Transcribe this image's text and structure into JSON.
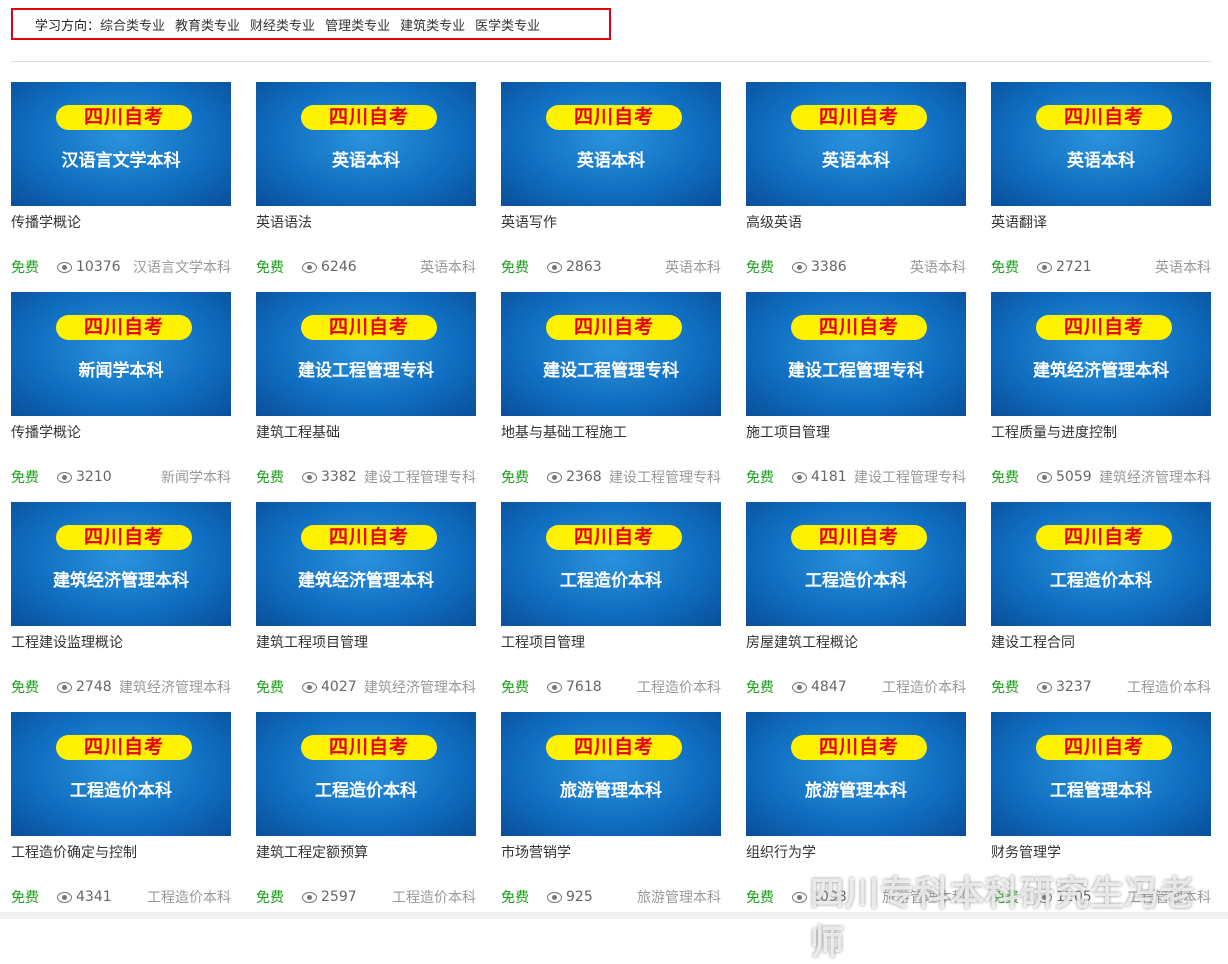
{
  "filter": {
    "label": "学习方向：",
    "options": [
      "综合类专业",
      "教育类专业",
      "财经类专业",
      "管理类专业",
      "建筑类专业",
      "医学类专业"
    ]
  },
  "badge": "四川自考",
  "free_label": "免费",
  "watermark": "四川专科本科研究生冯老师",
  "courses": [
    {
      "subtitle": "汉语言文学本科",
      "title": "传播学概论",
      "views": "10376",
      "category": "汉语言文学本科"
    },
    {
      "subtitle": "英语本科",
      "title": "英语语法",
      "views": "6246",
      "category": "英语本科"
    },
    {
      "subtitle": "英语本科",
      "title": "英语写作",
      "views": "2863",
      "category": "英语本科"
    },
    {
      "subtitle": "英语本科",
      "title": "高级英语",
      "views": "3386",
      "category": "英语本科"
    },
    {
      "subtitle": "英语本科",
      "title": "英语翻译",
      "views": "2721",
      "category": "英语本科"
    },
    {
      "subtitle": "新闻学本科",
      "title": "传播学概论",
      "views": "3210",
      "category": "新闻学本科"
    },
    {
      "subtitle": "建设工程管理专科",
      "title": "建筑工程基础",
      "views": "3382",
      "category": "建设工程管理专科"
    },
    {
      "subtitle": "建设工程管理专科",
      "title": "地基与基础工程施工",
      "views": "2368",
      "category": "建设工程管理专科"
    },
    {
      "subtitle": "建设工程管理专科",
      "title": "施工项目管理",
      "views": "4181",
      "category": "建设工程管理专科"
    },
    {
      "subtitle": "建筑经济管理本科",
      "title": "工程质量与进度控制",
      "views": "5059",
      "category": "建筑经济管理本科"
    },
    {
      "subtitle": "建筑经济管理本科",
      "title": "工程建设监理概论",
      "views": "2748",
      "category": "建筑经济管理本科"
    },
    {
      "subtitle": "建筑经济管理本科",
      "title": "建筑工程项目管理",
      "views": "4027",
      "category": "建筑经济管理本科"
    },
    {
      "subtitle": "工程造价本科",
      "title": "工程项目管理",
      "views": "7618",
      "category": "工程造价本科"
    },
    {
      "subtitle": "工程造价本科",
      "title": "房屋建筑工程概论",
      "views": "4847",
      "category": "工程造价本科"
    },
    {
      "subtitle": "工程造价本科",
      "title": "建设工程合同",
      "views": "3237",
      "category": "工程造价本科"
    },
    {
      "subtitle": "工程造价本科",
      "title": "工程造价确定与控制",
      "views": "4341",
      "category": "工程造价本科"
    },
    {
      "subtitle": "工程造价本科",
      "title": "建筑工程定额预算",
      "views": "2597",
      "category": "工程造价本科"
    },
    {
      "subtitle": "旅游管理本科",
      "title": "市场营销学",
      "views": "925",
      "category": "旅游管理本科"
    },
    {
      "subtitle": "旅游管理本科",
      "title": "组织行为学",
      "views": "1098",
      "category": "旅游管理本科"
    },
    {
      "subtitle": "工程管理本科",
      "title": "财务管理学",
      "views": "1205",
      "category": "工程管理本科"
    }
  ]
}
